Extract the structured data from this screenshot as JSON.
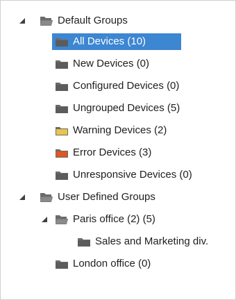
{
  "colors": {
    "selected_bg": "#3c86d2",
    "folder_dark": "#6b6b6b",
    "folder_warning": "#e8c64a",
    "folder_error": "#e0571f"
  },
  "tree": {
    "default_groups": {
      "label": "Default Groups",
      "icon": "folder-open-icon",
      "expanded": true,
      "items": [
        {
          "label": "All Devices (10)",
          "icon": "folder-icon",
          "selected": true
        },
        {
          "label": "New Devices (0)",
          "icon": "folder-icon"
        },
        {
          "label": "Configured Devices (0)",
          "icon": "folder-icon"
        },
        {
          "label": "Ungrouped Devices (5)",
          "icon": "folder-icon"
        },
        {
          "label": "Warning Devices (2)",
          "icon": "folder-warning-icon"
        },
        {
          "label": "Error Devices (3)",
          "icon": "folder-error-icon"
        },
        {
          "label": "Unresponsive Devices (0)",
          "icon": "folder-icon"
        }
      ]
    },
    "user_groups": {
      "label": "User Defined Groups",
      "icon": "folder-open-icon",
      "expanded": true,
      "paris": {
        "label": "Paris office (2) (5)",
        "icon": "folder-open-icon",
        "expanded": true,
        "children": [
          {
            "label": "Sales and Marketing div.",
            "icon": "folder-icon"
          }
        ]
      },
      "london": {
        "label": "London office (0)",
        "icon": "folder-icon"
      }
    }
  }
}
